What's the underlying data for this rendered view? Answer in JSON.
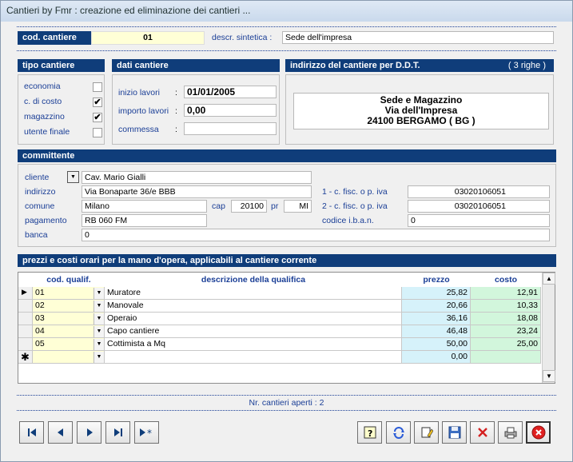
{
  "window": {
    "title": "Cantieri by Fmr : creazione ed eliminazione dei cantieri ..."
  },
  "header": {
    "cod_label": "cod. cantiere",
    "cod_value": "01",
    "descr_label": "descr. sintetica :",
    "descr_value": "Sede dell'impresa"
  },
  "tipo": {
    "title": "tipo cantiere",
    "items": [
      {
        "label": "economia",
        "checked": ""
      },
      {
        "label": "c. di costo",
        "checked": "✔"
      },
      {
        "label": "magazzino",
        "checked": "✔"
      },
      {
        "label": "utente finale",
        "checked": ""
      }
    ]
  },
  "dati": {
    "title": "dati cantiere",
    "inizio_label": "inizio lavori",
    "inizio_value": "01/01/2005",
    "importo_label": "importo lavori",
    "importo_value": "0,00",
    "commessa_label": "commessa",
    "commessa_value": "",
    "colon": ":"
  },
  "indirizzo": {
    "title": "indirizzo del cantiere per D.D.T.",
    "rows_note": "( 3 righe )",
    "line1": "Sede e Magazzino",
    "line2": "Via dell'Impresa",
    "line3": "24100 BERGAMO ( BG )"
  },
  "committente": {
    "title": "committente",
    "cliente_label": "cliente",
    "cliente_value": "Cav. Mario Gialli",
    "indirizzo_label": "indirizzo",
    "indirizzo_value": "Via Bonaparte 36/e BBB",
    "comune_label": "comune",
    "comune_value": "Milano",
    "cap_label": "cap",
    "cap_value": "20100",
    "pr_label": "pr",
    "pr_value": "MI",
    "pagamento_label": "pagamento",
    "pagamento_value": "RB 060 FM",
    "banca_label": "banca",
    "banca_value": "0",
    "cf1_label": "1 - c. fisc. o p. iva",
    "cf1_value": "03020106051",
    "cf2_label": "2 - c. fisc. o p. iva",
    "cf2_value": "03020106051",
    "iban_label": "codice i.b.a.n.",
    "iban_value": "0"
  },
  "prezzi": {
    "title": "prezzi e costi orari per la mano d'opera, applicabili al cantiere corrente",
    "columns": {
      "cod": "cod. qualif.",
      "descr": "descrizione della qualifica",
      "prezzo": "prezzo",
      "costo": "costo"
    },
    "rows": [
      {
        "cod": "01",
        "descr": "Muratore",
        "prezzo": "25,82",
        "costo": "12,91"
      },
      {
        "cod": "02",
        "descr": "Manovale",
        "prezzo": "20,66",
        "costo": "10,33"
      },
      {
        "cod": "03",
        "descr": "Operaio",
        "prezzo": "36,16",
        "costo": "18,08"
      },
      {
        "cod": "04",
        "descr": "Capo cantiere",
        "prezzo": "46,48",
        "costo": "23,24"
      },
      {
        "cod": "05",
        "descr": "Cottimista a Mq",
        "prezzo": "50,00",
        "costo": "25,00"
      }
    ],
    "new_row": {
      "prezzo": "0,00"
    }
  },
  "status": {
    "aperti": "Nr. cantieri aperti : 2"
  },
  "colors": {
    "bar": "#0f3d7a",
    "label": "#1a3e96",
    "cod_bg": "#ffffd6",
    "prezzo_bg": "#d6f2fa",
    "costo_bg": "#d2f6dc"
  }
}
